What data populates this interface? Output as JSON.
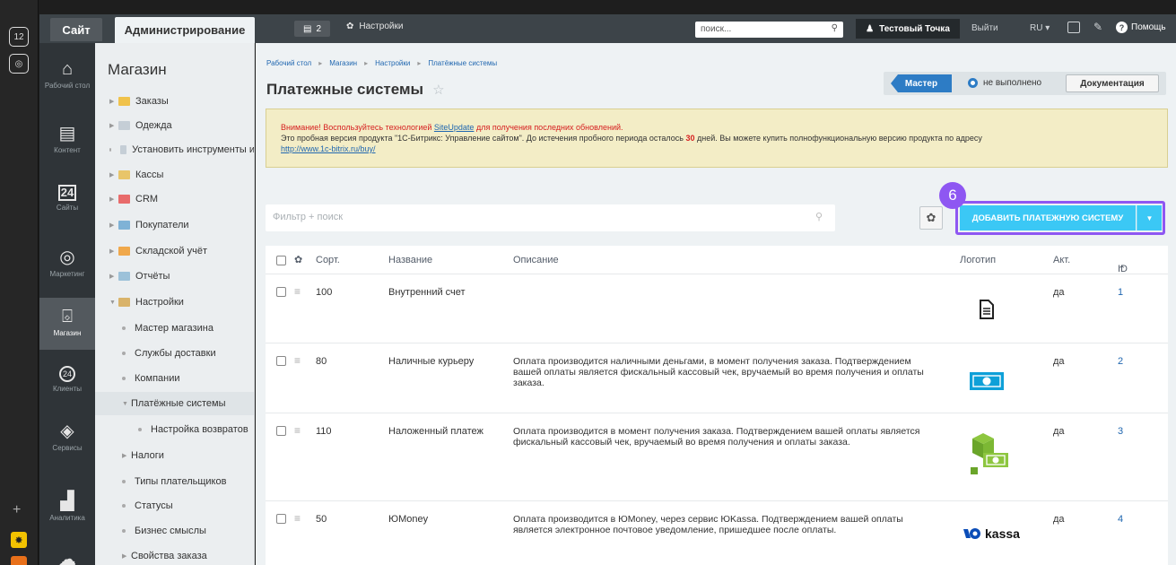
{
  "dock": {
    "counter": "12"
  },
  "topbar": {
    "site_tab": "Сайт",
    "admin_tab": "Администрирование",
    "badge_count": "2",
    "settings": "Настройки",
    "search_placeholder": "поиск...",
    "user": "Тестовый Точка",
    "logout": "Выйти",
    "lang": "RU",
    "help": "Помощь"
  },
  "leftnav": [
    {
      "label": "Рабочий стол",
      "icon": "home-icon"
    },
    {
      "label": "Контент",
      "icon": "content-icon"
    },
    {
      "label": "Сайты",
      "icon": "calendar-icon"
    },
    {
      "label": "Маркетинг",
      "icon": "target-icon"
    },
    {
      "label": "Магазин",
      "icon": "basket-icon"
    },
    {
      "label": "Клиенты",
      "icon": "clients-icon"
    },
    {
      "label": "Сервисы",
      "icon": "layers-icon"
    },
    {
      "label": "Аналитика",
      "icon": "chart-icon"
    }
  ],
  "dock_extra": {
    "calendar_num": "24",
    "clients_num": "24"
  },
  "secmenu": {
    "title": "Магазин",
    "items": [
      "Заказы",
      "Одежда",
      "Установить инструменты и",
      "Кассы",
      "CRM",
      "Покупатели",
      "Складской учёт",
      "Отчёты",
      "Настройки",
      "Мастер магазина",
      "Службы доставки",
      "Компании",
      "Платёжные системы",
      "Настройка возвратов",
      "Налоги",
      "Типы плательщиков",
      "Статусы",
      "Бизнес смыслы",
      "Свойства заказа"
    ]
  },
  "breadcrumb": [
    "Рабочий стол",
    "Магазин",
    "Настройки",
    "Платёжные системы"
  ],
  "page_title": "Платежные системы",
  "wizard": {
    "button": "Мастер",
    "status": "не выполнено",
    "docs": "Документация"
  },
  "notice": {
    "warn_prefix": "Внимание! Воспользуйтесь технологией ",
    "warn_link": "SiteUpdate",
    "warn_suffix": " для получения последних обновлений.",
    "line2_a": "Это пробная версия продукта \"1С-Битрикс: Управление сайтом\". До истечения пробного периода осталось ",
    "days": "30",
    "line2_b": " дней. Вы можете купить полнофункциональную версию продукта по адресу",
    "link": "http://www.1c-bitrix.ru/buy/"
  },
  "filter_placeholder": "Фильтр + поиск",
  "add_button": "ДОБАВИТЬ ПЛАТЕЖНУЮ СИСТЕМУ",
  "step_marker": "6",
  "grid": {
    "headers": {
      "sort": "Сорт.",
      "name": "Название",
      "desc": "Описание",
      "logo": "Логотип",
      "active": "Акт.",
      "id": "ID"
    },
    "rows": [
      {
        "sort": "100",
        "name": "Внутренний счет",
        "desc": "",
        "active": "да",
        "id": "1",
        "logo": "document-icon"
      },
      {
        "sort": "80",
        "name": "Наличные курьеру",
        "desc": "Оплата производится наличными деньгами, в момент получения заказа. Подтверждением вашей оплаты является фискальный кассовый чек, вручаемый во время получения и оплаты заказа.",
        "active": "да",
        "id": "2",
        "logo": "cash-icon"
      },
      {
        "sort": "110",
        "name": "Наложенный платеж",
        "desc": "Оплата производится в момент получения заказа. Подтверждением вашей оплаты является фискальный кассовый чек, вручаемый во время получения и оплаты заказа.",
        "active": "да",
        "id": "3",
        "logo": "box-cash-icon"
      },
      {
        "sort": "50",
        "name": "ЮMoney",
        "desc": "Оплата производится в ЮMoney, через сервис ЮKassa. Подтверждением вашей оплаты является электронное почтовое уведомление, пришедшее после оплаты.",
        "active": "да",
        "id": "4",
        "logo": "kassa"
      }
    ]
  },
  "colors": {
    "accent": "#3bc8f5",
    "highlight": "#8e57f2",
    "link": "#2067b0"
  }
}
